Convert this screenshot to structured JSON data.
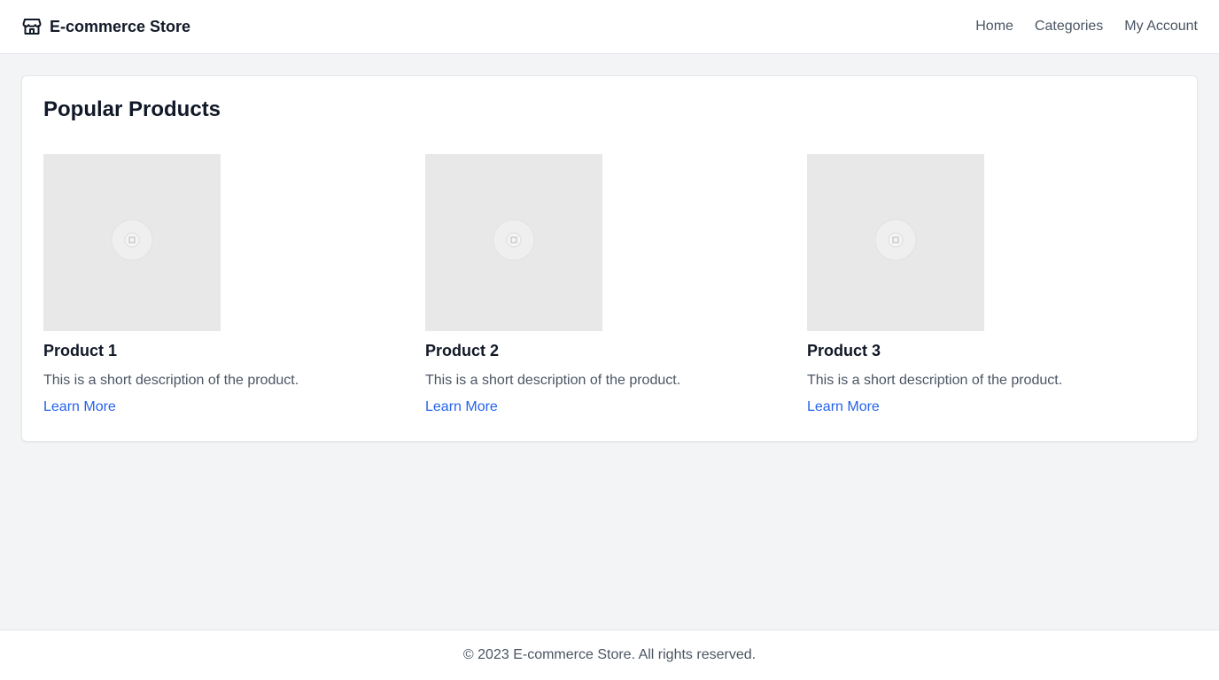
{
  "header": {
    "brand_icon": "storefront-icon",
    "brand_name": "E-commerce Store",
    "nav": [
      {
        "label": "Home"
      },
      {
        "label": "Categories"
      },
      {
        "label": "My Account"
      }
    ]
  },
  "main": {
    "section_title": "Popular Products",
    "products": [
      {
        "image_icon": "image-placeholder-icon",
        "name": "Product 1",
        "description": "This is a short description of the product.",
        "link_label": "Learn More"
      },
      {
        "image_icon": "image-placeholder-icon",
        "name": "Product 2",
        "description": "This is a short description of the product.",
        "link_label": "Learn More"
      },
      {
        "image_icon": "image-placeholder-icon",
        "name": "Product 3",
        "description": "This is a short description of the product.",
        "link_label": "Learn More"
      }
    ]
  },
  "footer": {
    "text": "© 2023 E-commerce Store. All rights reserved."
  },
  "colors": {
    "background": "#f3f4f6",
    "surface": "#ffffff",
    "link": "#2563eb",
    "muted_text": "#4b5563",
    "placeholder": "#e8e8e8"
  }
}
